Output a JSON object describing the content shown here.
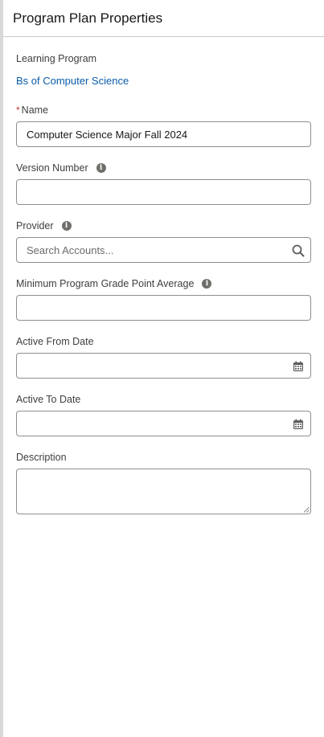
{
  "panel": {
    "title": "Program Plan Properties"
  },
  "learning_program": {
    "label": "Learning Program",
    "value": "Bs of Computer Science"
  },
  "name": {
    "required_mark": "*",
    "label": "Name",
    "value": "Computer Science Major Fall 2024"
  },
  "version_number": {
    "label": "Version Number",
    "value": "",
    "icon": "info-icon"
  },
  "provider": {
    "label": "Provider",
    "placeholder": "Search Accounts...",
    "icon": "info-icon",
    "search_icon": "search-icon"
  },
  "min_gpa": {
    "label": "Minimum Program Grade Point Average",
    "value": "",
    "icon": "info-icon"
  },
  "active_from": {
    "label": "Active From Date",
    "value": "",
    "icon": "calendar-icon"
  },
  "active_to": {
    "label": "Active To Date",
    "value": "",
    "icon": "calendar-icon"
  },
  "description": {
    "label": "Description",
    "value": ""
  },
  "colors": {
    "link": "#0b5cab",
    "required": "#c23934",
    "border": "#8e8e8e"
  }
}
